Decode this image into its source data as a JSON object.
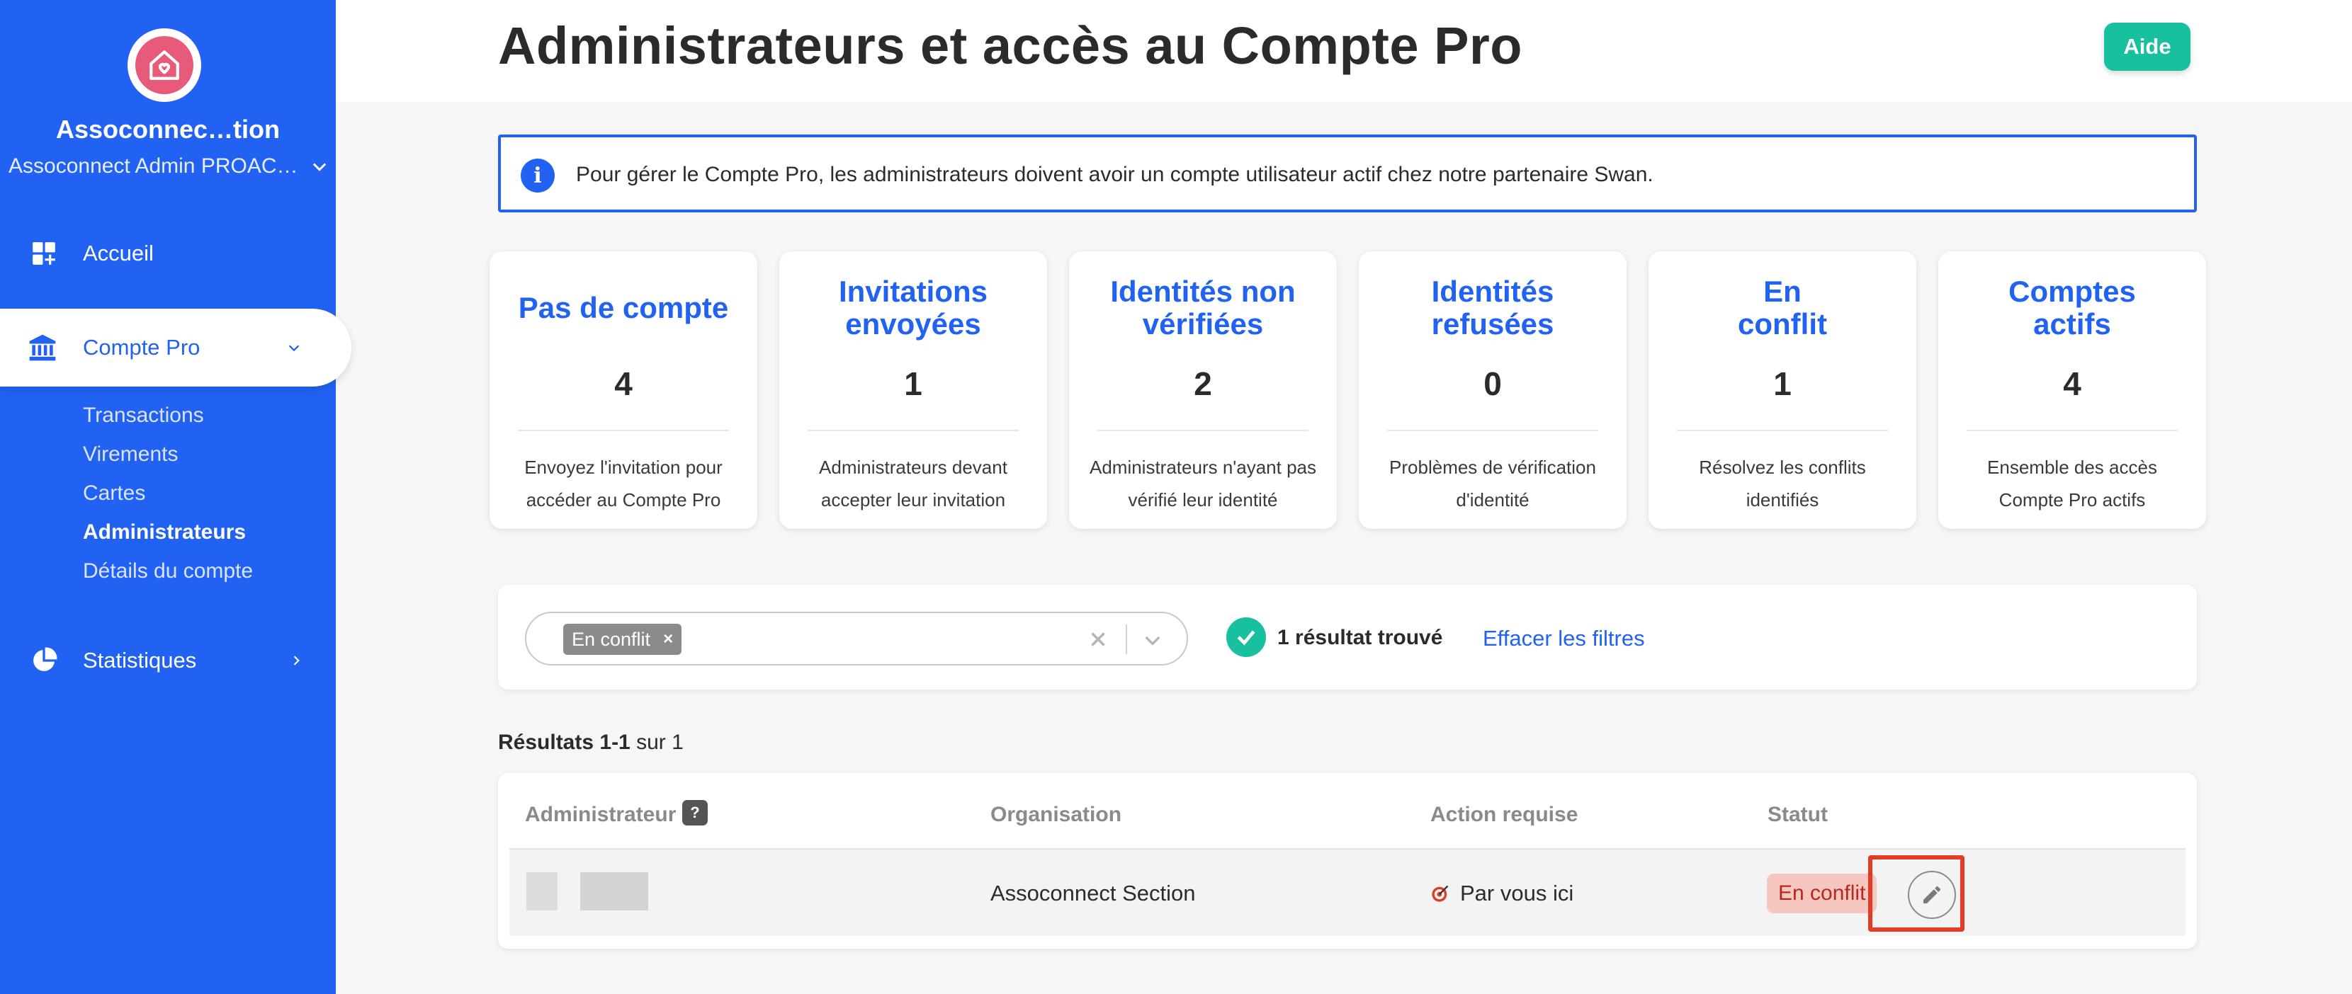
{
  "sidebar": {
    "org_name": "Assoconnec…tion",
    "org_sub": "Assoconnect Admin PROAC…",
    "nav": {
      "accueil": "Accueil",
      "compte_pro": "Compte Pro",
      "statistiques": "Statistiques"
    },
    "subnav": [
      "Transactions",
      "Virements",
      "Cartes",
      "Administrateurs",
      "Détails du compte"
    ]
  },
  "header": {
    "title": "Administrateurs et accès au Compte Pro",
    "help": "Aide"
  },
  "info": {
    "icon": "i",
    "text": "Pour gérer le Compte Pro, les administrateurs doivent avoir un compte utilisateur actif chez notre partenaire Swan."
  },
  "cards": [
    {
      "title": "Pas de compte",
      "value": "4",
      "desc": "Envoyez l'invitation pour accéder au Compte Pro"
    },
    {
      "title": "Invitations envoyées",
      "value": "1",
      "desc": "Administrateurs devant accepter leur invitation"
    },
    {
      "title": "Identités non vérifiées",
      "value": "2",
      "desc": "Administrateurs n'ayant pas vérifié leur identité"
    },
    {
      "title": "Identités refusées",
      "value": "0",
      "desc": "Problèmes de vérification d'identité"
    },
    {
      "title": "En conflit",
      "value": "1",
      "desc": "Résolvez les conflits identifiés"
    },
    {
      "title": "Comptes actifs",
      "value": "4",
      "desc": "Ensemble des accès Compte Pro actifs"
    }
  ],
  "filter": {
    "chip": "En conflit",
    "chip_remove": "×",
    "result_count": "1 résultat trouvé",
    "clear": "Effacer les filtres"
  },
  "results": {
    "range": "Résultats 1-1",
    "total": "sur 1"
  },
  "table": {
    "headers": {
      "admin": "Administrateur",
      "org": "Organisation",
      "action": "Action requise",
      "status": "Statut"
    },
    "help_q": "?",
    "rows": [
      {
        "organisation": "Assoconnect Section",
        "action": "Par vous ici",
        "status": "En conflit"
      }
    ]
  },
  "colors": {
    "brand": "#2262f2",
    "accent": "#19c0a0",
    "conflict_bg": "#f6c6c1",
    "highlight": "#e23c27"
  }
}
